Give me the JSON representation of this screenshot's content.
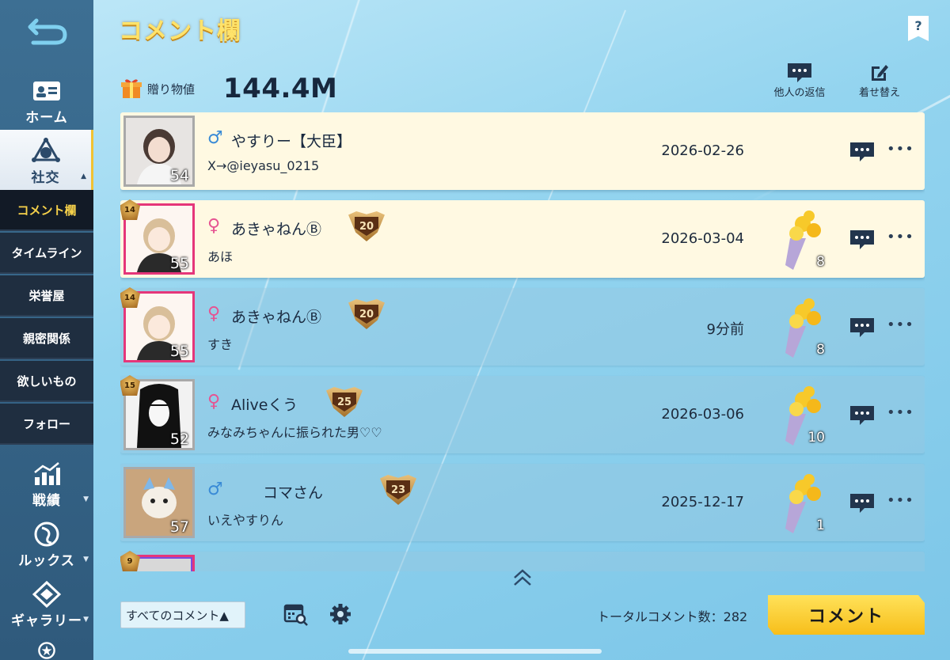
{
  "page": {
    "title": "コメント欄",
    "help_label": "?"
  },
  "sidebar": {
    "home": "ホーム",
    "social": "社交",
    "social_caret": "▲",
    "sub_items": [
      "コメント欄",
      "タイムライン",
      "栄誉屋",
      "親密関係",
      "欲しいもの",
      "フォロー"
    ],
    "stats": "戦績",
    "looks": "ルックス",
    "gallery": "ギャラリー",
    "collapsed_caret": "▼"
  },
  "gift": {
    "label": "贈り物値",
    "value": "144.4M"
  },
  "tools": {
    "others_reply": "他人の返信",
    "change_outfit": "着せ替え"
  },
  "comments": [
    {
      "gender_symbol": "♂",
      "name": "やすりー【大臣】",
      "rank": "",
      "text": "X→@ieyasu_0215",
      "date": "2026-02-26",
      "level": "54",
      "frame_level": "",
      "bouquet_count": ""
    },
    {
      "gender_symbol": "♀",
      "name": "あきゃねんⒷ",
      "rank": "20",
      "text": "あほ",
      "date": "2026-03-04",
      "level": "55",
      "frame_level": "14",
      "bouquet_count": "8"
    },
    {
      "gender_symbol": "♀",
      "name": "あきゃねんⒷ",
      "rank": "20",
      "text": "すき",
      "date": "9分前",
      "level": "55",
      "frame_level": "14",
      "bouquet_count": "8"
    },
    {
      "gender_symbol": "♀",
      "name": "Aliveくう",
      "rank": "25",
      "text": "みなみちゃんに振られた男♡♡",
      "date": "2026-03-06",
      "level": "52",
      "frame_level": "15",
      "bouquet_count": "10"
    },
    {
      "gender_symbol": "♂",
      "name": "コマさん",
      "rank": "23",
      "text": "いえやすりん",
      "date": "2025-12-17",
      "level": "57",
      "frame_level": "",
      "bouquet_count": "1"
    },
    {
      "gender_symbol": "",
      "name": "",
      "rank": "",
      "text": "",
      "date": "",
      "level": "",
      "frame_level": "9",
      "bouquet_count": ""
    }
  ],
  "more_label": "•••",
  "bottom": {
    "filter_label": "すべてのコメント▲",
    "total_label": "トータルコメント数：282",
    "comment_button": "コメント"
  },
  "icons": {
    "back": "back-arrow-icon",
    "home": "id-card-icon",
    "social": "social-network-icon",
    "stats": "chart-icon",
    "looks": "looks-emblem-icon",
    "gallery": "gallery-emblem-icon",
    "gift": "gift-icon",
    "reply": "chat-bubble-icon",
    "edit": "edit-icon",
    "calendar": "calendar-search-icon",
    "gear": "gear-icon",
    "scroll": "chevron-double-up-icon"
  },
  "colors": {
    "accent_yellow": "#ffe36a",
    "male": "#3a8bd6",
    "female": "#e65492",
    "highlight_row": "#fff9e2",
    "sidebar": "#2f5a7c"
  }
}
